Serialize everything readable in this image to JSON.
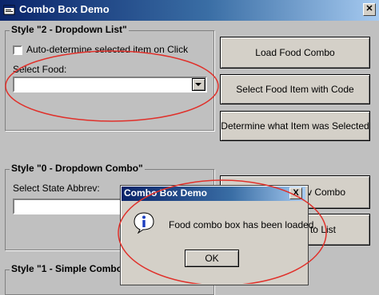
{
  "window": {
    "title": "Combo Box Demo",
    "close_glyph": "✕"
  },
  "frame1": {
    "title": "Style \"2 - Dropdown List\"",
    "checkbox_label": "Auto-determine selected item on Click",
    "select_label": "Select Food:",
    "select_value": ""
  },
  "buttons": {
    "load_food": "Load Food Combo",
    "select_food_code": "Select Food Item with Code",
    "determine_item": "Determine what Item was Selected",
    "abbrev_combo_partial": "rev Combo",
    "to_list_partial": "n to List"
  },
  "frame2": {
    "title": "Style \"0 - Dropdown Combo\"",
    "state_label": "Select State Abbrev:",
    "state_value": ""
  },
  "frame3": {
    "title": "Style \"1 - Simple Combo\""
  },
  "dialog": {
    "title": "Combo Box Demo",
    "close_glyph": "X",
    "message": "Food combo box has been loaded.",
    "ok_label": "OK",
    "icon_glyph": "i"
  },
  "colors": {
    "titlebar_start": "#0a246a",
    "titlebar_end": "#a6caf0",
    "annotation_ellipse": "#e0302a",
    "window_bg": "#c0c0c0"
  },
  "icons": [
    "app-icon",
    "chevron-down-icon",
    "information-icon",
    "close-icon"
  ]
}
